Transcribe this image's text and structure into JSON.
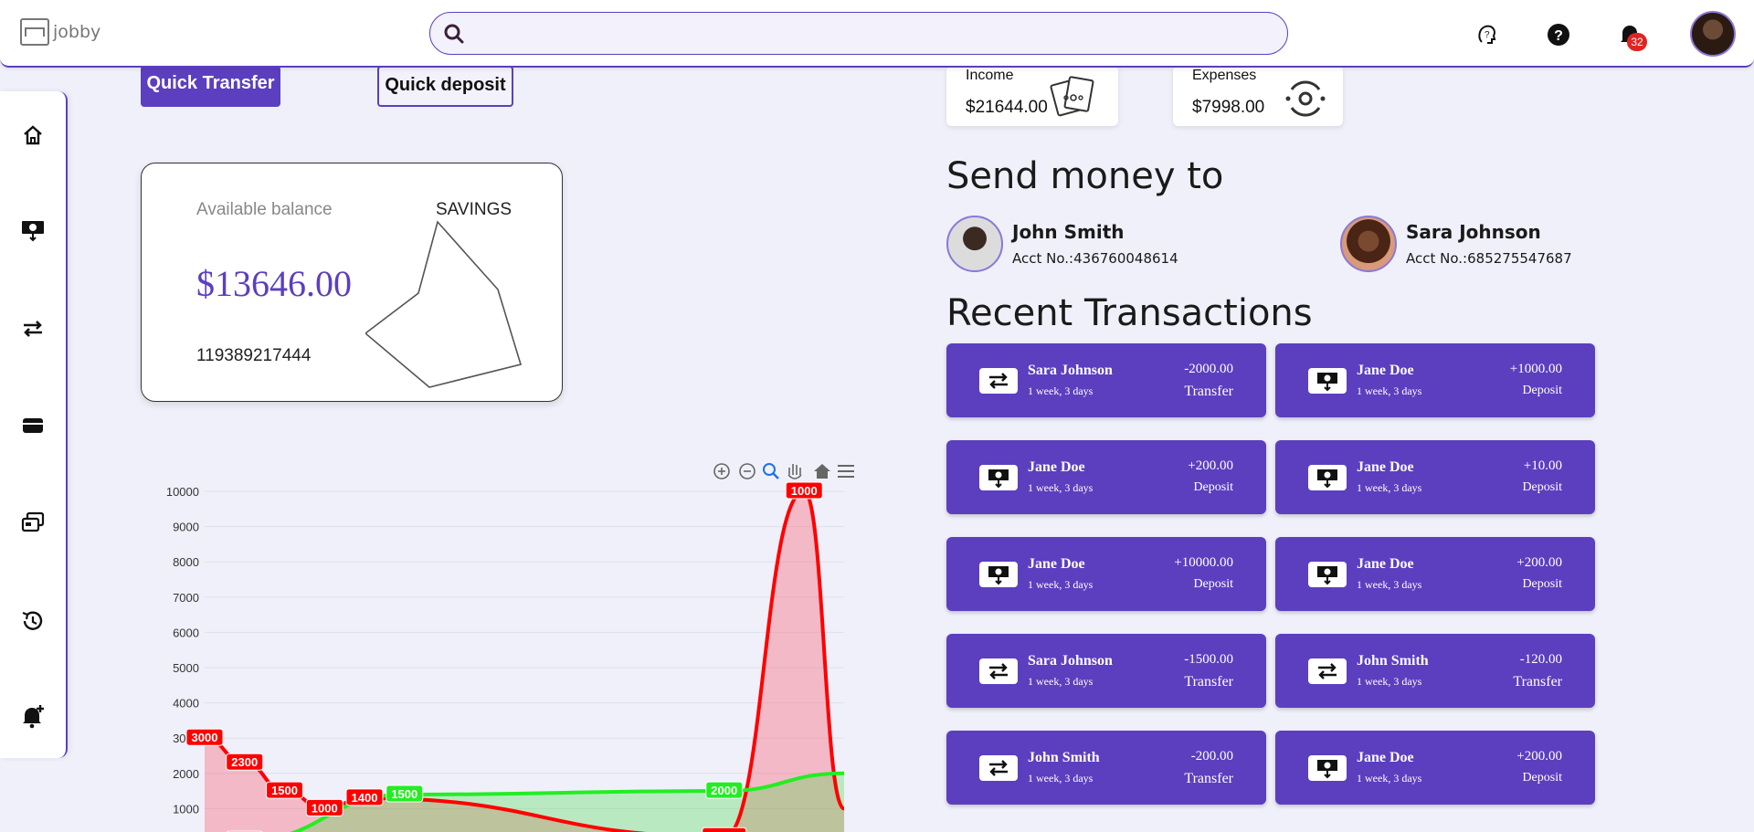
{
  "app": {
    "logo_text": "jobby"
  },
  "header": {
    "search_placeholder": "",
    "notifications_count": "32",
    "icons": [
      "help-brain-icon",
      "question-icon",
      "bell-icon"
    ]
  },
  "sidebar": {
    "items": [
      "home-icon",
      "money-deposit-icon",
      "transfer-arrows-icon",
      "card-icon",
      "cards-stack-icon",
      "history-icon",
      "bell-add-icon"
    ]
  },
  "quick": {
    "transfer_label": "Quick Transfer",
    "deposit_label": "Quick deposit"
  },
  "balance": {
    "label": "Available balance",
    "type": "SAVINGS",
    "amount": "$13646.00",
    "account": "119389217444"
  },
  "stats": {
    "income_label": "Income",
    "income_value": "$21644.00",
    "expenses_label": "Expenses",
    "expenses_value": "$7998.00"
  },
  "send_money": {
    "title": "Send money to",
    "contacts": [
      {
        "name": "John Smith",
        "acct_label": "Acct No.:",
        "acct": "436760048614"
      },
      {
        "name": "Sara Johnson",
        "acct_label": "Acct No.:",
        "acct": "685275547687"
      }
    ]
  },
  "recent": {
    "title": "Recent Transactions",
    "items": [
      {
        "name": "Sara Johnson",
        "time": "1 week, 3 days",
        "amount": "-2000.00",
        "type": "Transfer",
        "icon": "transfer-icon"
      },
      {
        "name": "Jane Doe",
        "time": "1 week, 3 days",
        "amount": "+1000.00",
        "type": "Deposit",
        "icon": "deposit-icon"
      },
      {
        "name": "Jane Doe",
        "time": "1 week, 3 days",
        "amount": "+200.00",
        "type": "Deposit",
        "icon": "deposit-icon"
      },
      {
        "name": "Jane Doe",
        "time": "1 week, 3 days",
        "amount": "+10.00",
        "type": "Deposit",
        "icon": "deposit-icon"
      },
      {
        "name": "Jane Doe",
        "time": "1 week, 3 days",
        "amount": "+10000.00",
        "type": "Deposit",
        "icon": "deposit-icon"
      },
      {
        "name": "Jane Doe",
        "time": "1 week, 3 days",
        "amount": "+200.00",
        "type": "Deposit",
        "icon": "deposit-icon"
      },
      {
        "name": "Sara Johnson",
        "time": "1 week, 3 days",
        "amount": "-1500.00",
        "type": "Transfer",
        "icon": "transfer-icon"
      },
      {
        "name": "John Smith",
        "time": "1 week, 3 days",
        "amount": "-120.00",
        "type": "Transfer",
        "icon": "transfer-icon"
      },
      {
        "name": "John Smith",
        "time": "1 week, 3 days",
        "amount": "-200.00",
        "type": "Transfer",
        "icon": "transfer-icon"
      },
      {
        "name": "Jane Doe",
        "time": "1 week, 3 days",
        "amount": "+200.00",
        "type": "Deposit",
        "icon": "deposit-icon"
      }
    ]
  },
  "chart_data": {
    "type": "area",
    "ylim": [
      0,
      10000
    ],
    "yticks": [
      "10000",
      "9000",
      "8000",
      "7000",
      "6000",
      "5000",
      "4000",
      "3000",
      "2000",
      "1000"
    ],
    "series": [
      {
        "color": "#ff0000",
        "points": [
          [
            0,
            3000
          ],
          [
            1,
            2300
          ],
          [
            2,
            1500
          ],
          [
            3,
            1000
          ],
          [
            4,
            1300
          ],
          [
            13,
            200
          ],
          [
            15,
            10000
          ],
          [
            16,
            1000
          ]
        ],
        "labels": [
          "3000",
          "2300",
          "1500",
          "1000",
          "1400",
          "10000",
          "1000"
        ]
      },
      {
        "color": "#22ee22",
        "points": [
          [
            1,
            100
          ],
          [
            5,
            1400
          ],
          [
            13,
            1500
          ],
          [
            16,
            2000
          ]
        ],
        "labels": [
          "1400",
          "1500",
          "2000"
        ]
      }
    ],
    "toolbar_icons": [
      "zoom-in-icon",
      "zoom-out-icon",
      "zoom-select-icon",
      "pan-hand-icon",
      "reset-home-icon",
      "menu-icon"
    ]
  }
}
